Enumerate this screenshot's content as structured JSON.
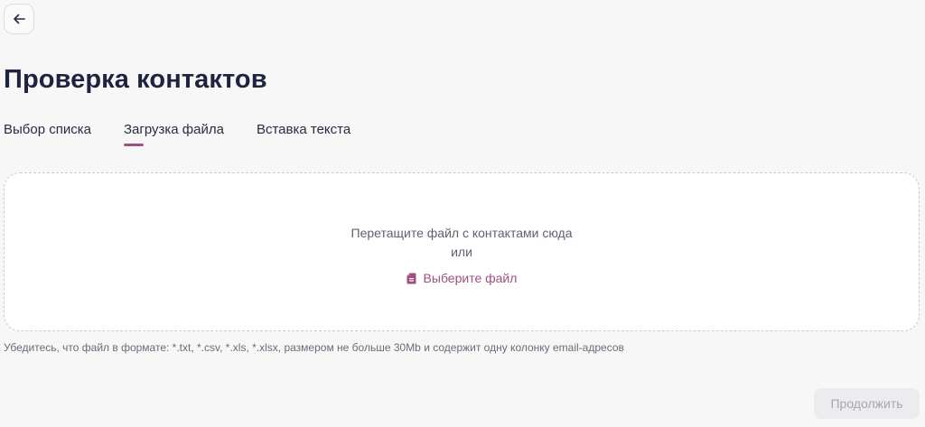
{
  "header": {
    "back_icon": "arrow-left-icon",
    "title": "Проверка контактов"
  },
  "tabs": [
    {
      "label": "Выбор списка",
      "active": false
    },
    {
      "label": "Загрузка файла",
      "active": true
    },
    {
      "label": "Вставка текста",
      "active": false
    }
  ],
  "dropzone": {
    "drag_text": "Перетащите файл с контактами сюда",
    "or_text": "или",
    "choose_label": "Выберите файл",
    "choose_icon": "file-icon"
  },
  "hint": "Убедитесь, что файл в формате: *.txt, *.csv, *.xls, *.xlsx, размером не больше 30Mb и содержит одну колонку email-адресов",
  "footer": {
    "continue_label": "Продолжить",
    "continue_disabled": true
  },
  "colors": {
    "accent": "#9c4f80",
    "title": "#1f2340",
    "background": "#f7f7f8"
  }
}
